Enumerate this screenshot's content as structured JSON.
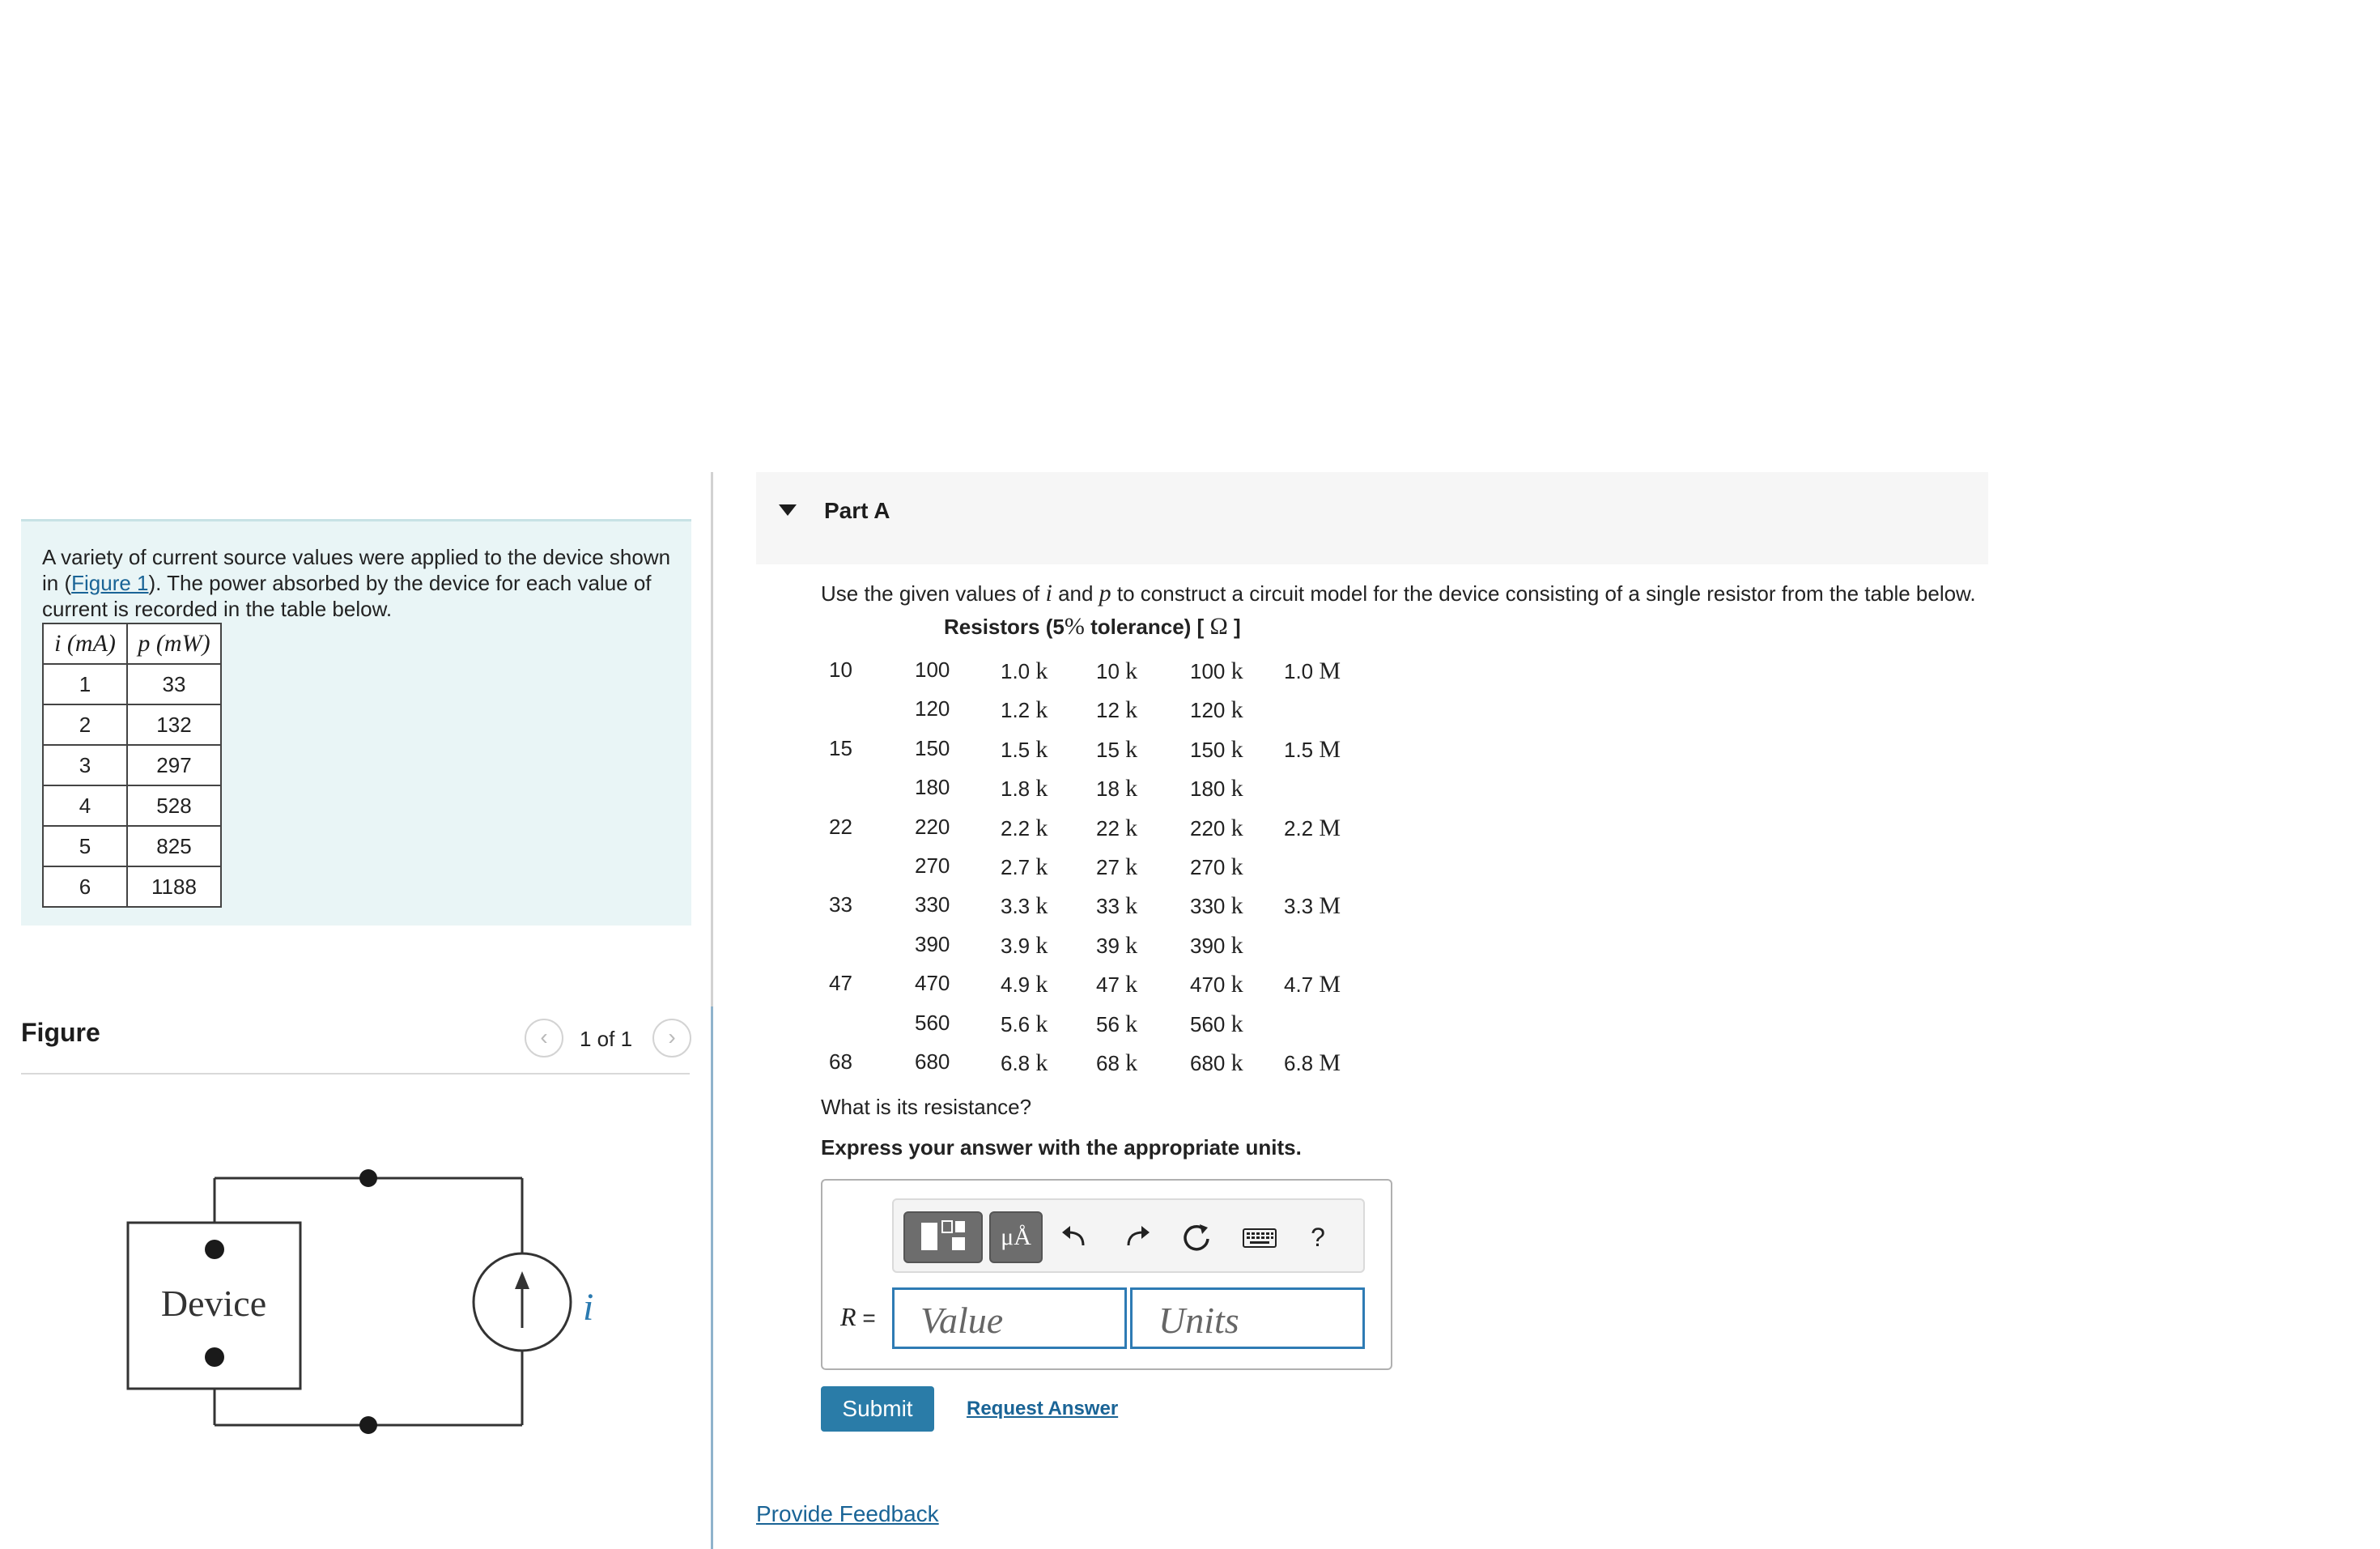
{
  "problem": {
    "text_before_link": "A variety of current source values were applied to the device shown in (",
    "link_text": "Figure 1",
    "text_after_link": "). The power absorbed by the device for each value of current is recorded in the table below.",
    "table": {
      "headers": [
        "i (mA)",
        "p (mW)"
      ],
      "rows": [
        [
          "1",
          "33"
        ],
        [
          "2",
          "132"
        ],
        [
          "3",
          "297"
        ],
        [
          "4",
          "528"
        ],
        [
          "5",
          "825"
        ],
        [
          "6",
          "1188"
        ]
      ]
    }
  },
  "figure": {
    "title": "Figure",
    "pager_text": "1 of 1",
    "prev_glyph": "‹",
    "next_glyph": "›",
    "device_label": "Device",
    "current_label": "i"
  },
  "part": {
    "title": "Part A",
    "question_parts": [
      "Use the given values of ",
      "i",
      " and ",
      "p",
      " to construct a circuit model for the device consisting of a single resistor from the table below."
    ],
    "resistor_title": "Resistors (5",
    "resistor_title_pct": "%",
    "resistor_title_mid": " tolerance) [ ",
    "resistor_title_omega": "Ω",
    "resistor_title_end": " ]",
    "resistor_rows": [
      [
        "10",
        "100",
        "1.0 k",
        "10 k",
        "100 k",
        "1.0 M"
      ],
      [
        "",
        "120",
        "1.2 k",
        "12 k",
        "120 k",
        ""
      ],
      [
        "15",
        "150",
        "1.5 k",
        "15 k",
        "150 k",
        "1.5 M"
      ],
      [
        "",
        "180",
        "1.8 k",
        "18 k",
        "180 k",
        ""
      ],
      [
        "22",
        "220",
        "2.2 k",
        "22 k",
        "220 k",
        "2.2 M"
      ],
      [
        "",
        "270",
        "2.7 k",
        "27 k",
        "270 k",
        ""
      ],
      [
        "33",
        "330",
        "3.3 k",
        "33 k",
        "330 k",
        "3.3 M"
      ],
      [
        "",
        "390",
        "3.9 k",
        "39 k",
        "390 k",
        ""
      ],
      [
        "47",
        "470",
        "4.9 k",
        "47 k",
        "470 k",
        "4.7 M"
      ],
      [
        "",
        "560",
        "5.6 k",
        "56 k",
        "560 k",
        ""
      ],
      [
        "68",
        "680",
        "6.8 k",
        "68 k",
        "680 k",
        "6.8 M"
      ]
    ],
    "question2": "What is its resistance?",
    "instruction": "Express your answer with the appropriate units.",
    "answer_label_var": "R",
    "answer_label_eq": " =",
    "value_placeholder": "Value",
    "units_placeholder": "Units",
    "units_button_label": "μÅ",
    "help_label": "?",
    "submit_label": "Submit",
    "request_answer_label": "Request Answer"
  },
  "feedback_label": "Provide Feedback",
  "colors": {
    "problem_bg": "#e9f5f6",
    "link": "#1a6496",
    "submit_bg": "#2a7ca8",
    "input_border": "#2e7bb4"
  },
  "icons": [
    "caret-down-icon",
    "chevron-left-icon",
    "chevron-right-icon",
    "templates-icon",
    "undo-icon",
    "redo-icon",
    "reset-icon",
    "keyboard-icon",
    "help-icon"
  ]
}
